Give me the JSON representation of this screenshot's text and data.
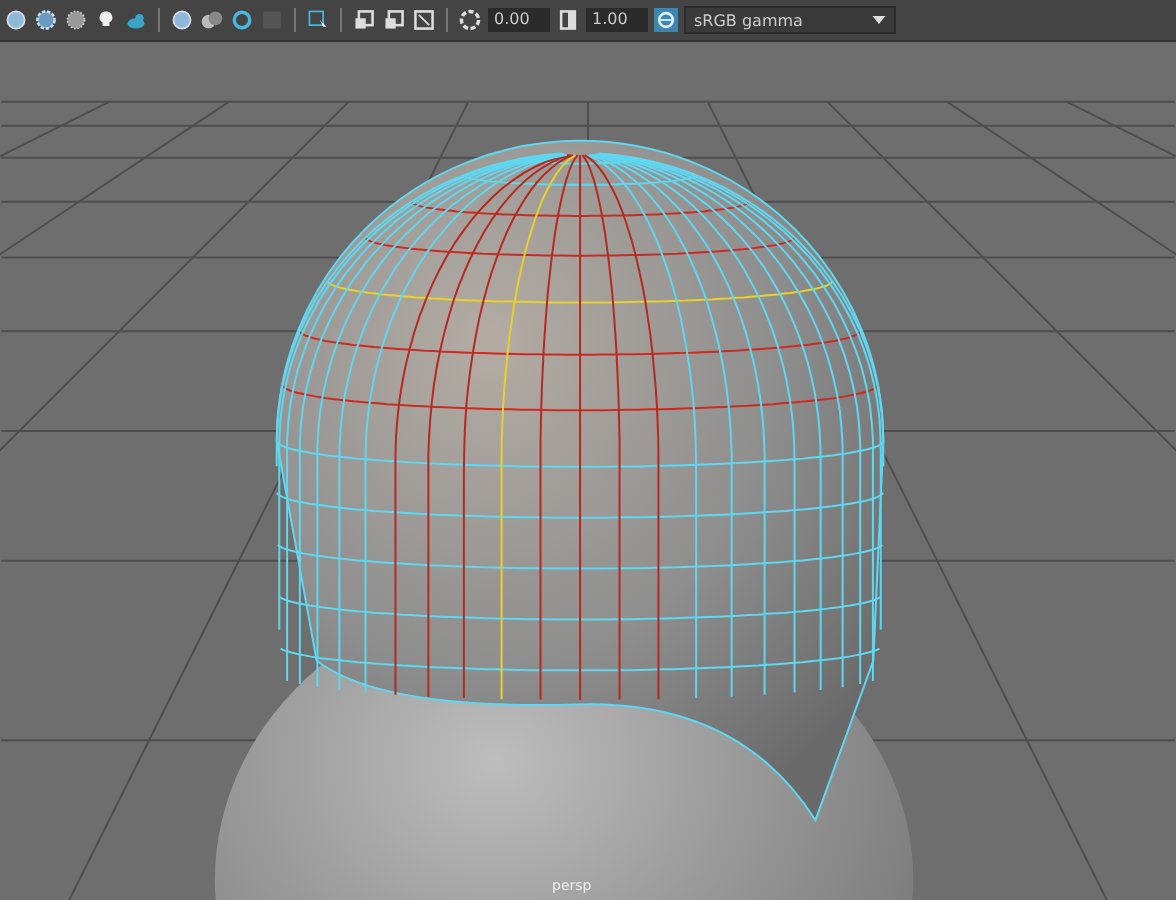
{
  "toolbar": {
    "exposure": "0.00",
    "gamma": "1.00",
    "color_management": {
      "on": true,
      "colorspace": "sRGB gamma"
    }
  },
  "viewport": {
    "camera": "persp"
  }
}
